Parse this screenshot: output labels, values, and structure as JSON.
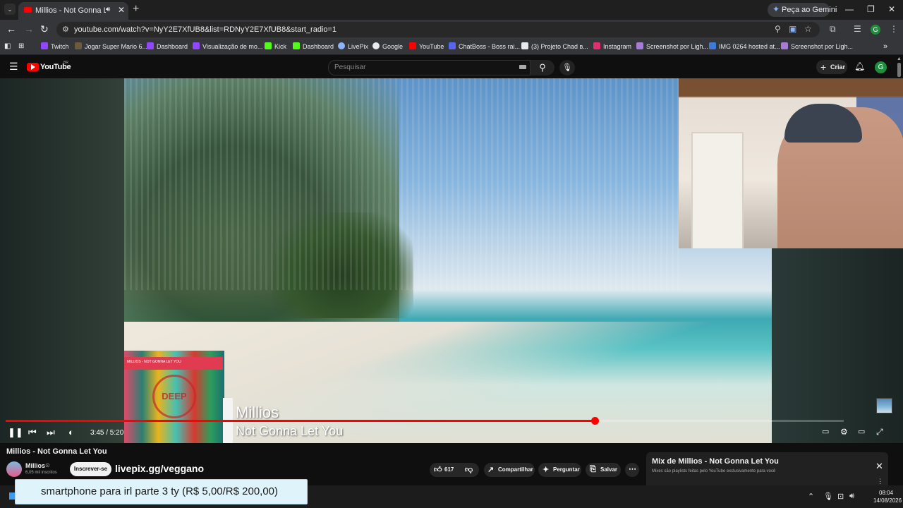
{
  "browser": {
    "tab": {
      "title": "Millios - Not Gonna Let You"
    },
    "gemini_label": "Peça ao Gemini",
    "url": "youtube.com/watch?v=NyY2E7XfUB8&list=RDNyY2E7XfUB8&start_radio=1",
    "profile_initial": "G",
    "bookmarks": [
      {
        "label": "Twitch",
        "color": "#9146ff"
      },
      {
        "label": "Jogar Super Mario 6...",
        "color": "#6b5a3b"
      },
      {
        "label": "Dashboard",
        "color": "#9146ff"
      },
      {
        "label": "Visualização de mo...",
        "color": "#9146ff"
      },
      {
        "label": "Kick",
        "color": "#53fc18"
      },
      {
        "label": "Dashboard",
        "color": "#53fc18"
      },
      {
        "label": "LivePix",
        "color": "#8ab4f8"
      },
      {
        "label": "Google",
        "color": "#e8eaed"
      },
      {
        "label": "YouTube",
        "color": "#ff0000"
      },
      {
        "label": "ChatBoss - Boss rai...",
        "color": "#5865f2"
      },
      {
        "label": "(3) Projeto Chad в...",
        "color": "#e8eaed"
      },
      {
        "label": "Instagram",
        "color": "#e1306c"
      },
      {
        "label": "Screenshot por Ligh...",
        "color": "#a77bd6"
      },
      {
        "label": "IMG 0264 hosted at...",
        "color": "#3d7bd6"
      },
      {
        "label": "Screenshot por Ligh...",
        "color": "#a77bd6"
      }
    ]
  },
  "youtube": {
    "logo_text": "YouTube",
    "logo_region": "BR",
    "search_placeholder": "Pesquisar",
    "create_label": "Criar",
    "avatar_initial": "G"
  },
  "player": {
    "overlay_artist": "Millios",
    "overlay_song": "Not Gonna Let You",
    "album_banner": "MILLIOS - NOT GONNA LET YOU",
    "album_mark": "DEEP",
    "time": "3:45 / 5:20",
    "progress_fraction": 0.7031
  },
  "video": {
    "title": "Millios - Not Gonna Let You",
    "channel": "Millios",
    "subscribers": "6,05 mil inscritos",
    "subscribe_label": "Inscrever-se",
    "stream_overlay": "livepix.gg/veggano",
    "likes": "617",
    "share_label": "Compartilhar",
    "ask_label": "Perguntar",
    "save_label": "Salvar"
  },
  "mix": {
    "title": "Mix de Millios - Not Gonna Let You",
    "subtitle": "Mixes são playlists feitas pelo YouTube exclusivamente para você"
  },
  "donation": {
    "text": "smartphone para irl parte 3 ty (R$ 5,00/R$ 200,00)"
  },
  "taskbar": {
    "time": "08:04",
    "date": "14/08/2026"
  },
  "colors": {
    "accent": "#ff0000",
    "background": "#0f0f0f"
  }
}
